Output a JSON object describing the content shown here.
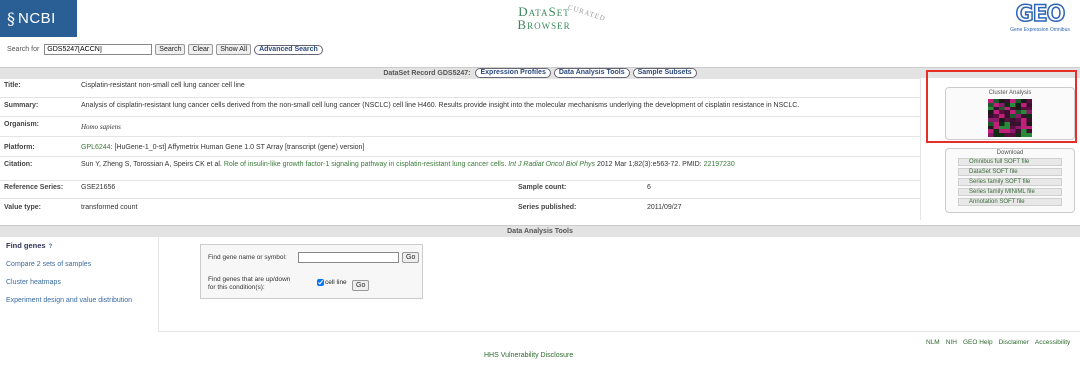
{
  "header": {
    "ncbi_logo": "NCBI",
    "title_line1": "DataSet",
    "title_line2": "Browser",
    "title_tag": "CURATED",
    "geo_logo": "GEO",
    "geo_subtitle": "Gene Expression Omnibus"
  },
  "search": {
    "label": "Search for",
    "value": "GDS5247[ACCN]",
    "search_btn": "Search",
    "clear_btn": "Clear",
    "show_all_btn": "Show All",
    "advanced_btn": "Advanced Search"
  },
  "record": {
    "header": "DataSet Record GDS5247:",
    "tabs": [
      "Expression Profiles",
      "Data Analysis Tools",
      "Sample Subsets"
    ],
    "title_key": "Title:",
    "title_val": "Cisplatin-resistant non-small cell lung cancer cell line",
    "summary_key": "Summary:",
    "summary_val": "Analysis of cisplatin-resistant lung cancer cells derived from the non-small cell lung cancer (NSCLC) cell line H460. Results provide insight into the molecular mechanisms underlying the development of cisplatin resistance in NSCLC.",
    "organism_key": "Organism:",
    "organism_val": "Homo sapiens",
    "platform_key": "Platform:",
    "platform_link": "GPL6244",
    "platform_val": ": [HuGene-1_0-st] Affymetrix Human Gene 1.0 ST Array [transcript (gene) version]",
    "citation_key": "Citation:",
    "citation_authors": "Sun Y, Zheng S, Torossian A, Speirs CK et al.",
    "citation_title": " Role of insulin-like growth factor-1 signaling pathway in cisplatin-resistant lung cancer cells. ",
    "citation_journal": "Int J Radiat Oncol Biol Phys",
    "citation_year": " 2012 Mar 1;82(3):e563-72. PMID: ",
    "citation_pmid": "22197230",
    "refseries_key": "Reference Series:",
    "refseries_val": "GSE21656",
    "samplecount_key": "Sample count:",
    "samplecount_val": "6",
    "valuetype_key": "Value type:",
    "valuetype_val": "transformed count",
    "published_key": "Series published:",
    "published_val": "2011/09/27"
  },
  "right_panel": {
    "cluster_title": "Cluster Analysis",
    "download_title": "Download",
    "downloads": [
      "Omnibus full SOFT file",
      "DataSet SOFT file",
      "Series family SOFT file",
      "Series family MINiML file",
      "Annotation SOFT file"
    ]
  },
  "tools": {
    "header": "Data Analysis Tools",
    "find_genes": "Find genes",
    "help": "?",
    "compare": "Compare 2 sets of samples",
    "heatmaps": "Cluster heatmaps",
    "experiment": "Experiment design and value distribution",
    "find_label": "Find gene name or symbol:",
    "go1": "Go",
    "updown_label_1": "Find genes that are up/down",
    "updown_label_2": "for this condition(s):",
    "cell_line": "cell line",
    "go2": "Go"
  },
  "footer": {
    "links": [
      "NLM",
      "NIH",
      "GEO Help",
      "Disclaimer",
      "Accessibility"
    ],
    "hhs": "HHS Vulnerability Disclosure"
  },
  "colors": {
    "ncbi_blue": "#2a5f96",
    "link_green": "#3a7a3a",
    "highlight_red": "#e5302a"
  }
}
